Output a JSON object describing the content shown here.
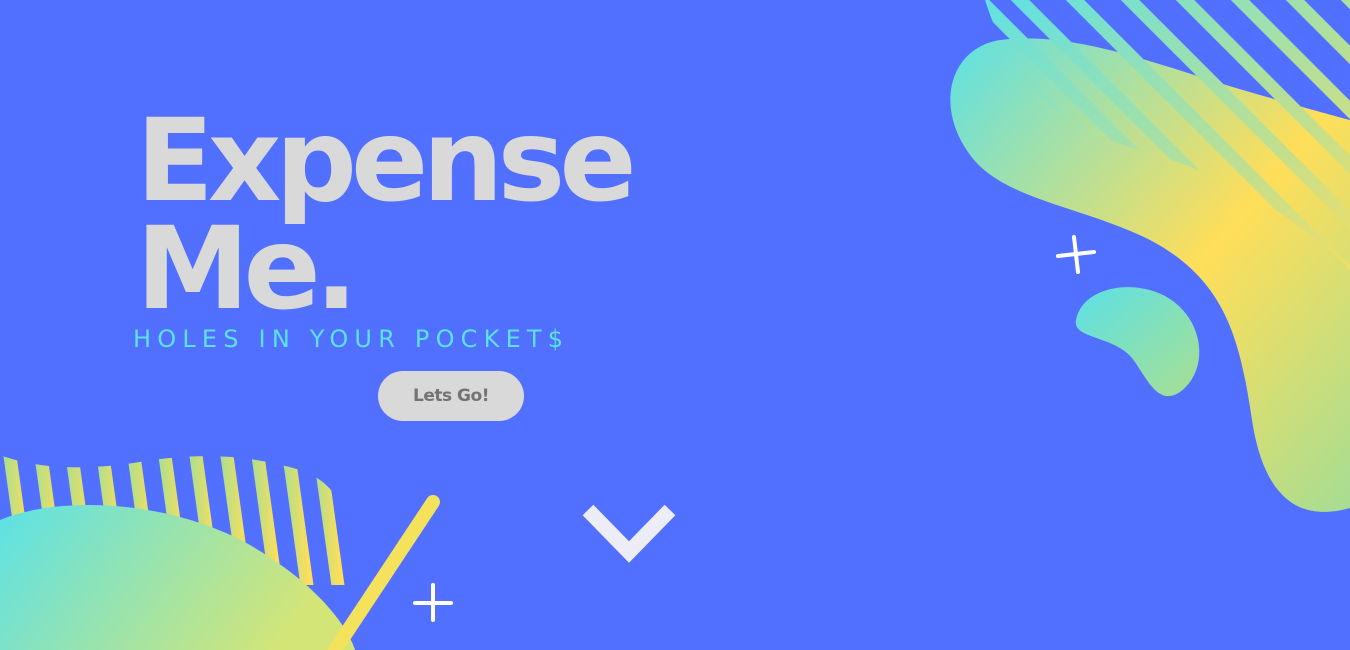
{
  "hero": {
    "title_line_1": "Expense",
    "title_line_2": "Me.",
    "tagline": "HOLES IN YOUR POCKET$",
    "cta_label": "Lets Go!",
    "scroll_icon": "chevron-down-icon"
  },
  "colors": {
    "background": "#5170FF",
    "title": "#D9D9D9",
    "tagline": "#5CE1E6",
    "button_bg": "#D9D9D9",
    "button_text": "#737373",
    "chevron": "#EDEDF7",
    "gradient_start": "#5CE1E6",
    "gradient_end": "#FFDE59",
    "plus_sign": "#FFFFFF"
  }
}
